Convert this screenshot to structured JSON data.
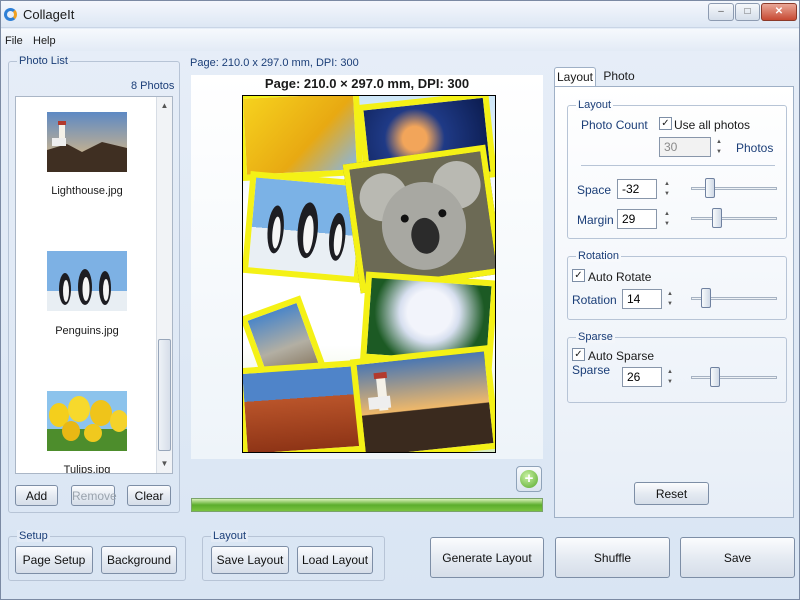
{
  "window": {
    "title": "CollageIt",
    "controls": [
      "–",
      "□",
      "✕"
    ]
  },
  "menu": {
    "file": "File",
    "help": "Help"
  },
  "photo_list": {
    "title": "Photo List",
    "count": "8 Photos",
    "items": [
      {
        "label": "Lighthouse.jpg"
      },
      {
        "label": "Penguins.jpg"
      },
      {
        "label": "Tulips.jpg"
      }
    ],
    "add": "Add",
    "remove": "Remove",
    "clear": "Clear"
  },
  "page": {
    "info_small": "Page: 210.0 x 297.0 mm, DPI: 300",
    "info_large": "Page: 210.0 × 297.0 mm, DPI: 300"
  },
  "tabs": {
    "layout": "Layout",
    "photo": "Photo",
    "active": "Layout"
  },
  "layout_group": {
    "title": "Layout",
    "photo_count_label": "Photo Count",
    "use_all_label": "Use all photos",
    "use_all_checked": true,
    "photo_count_value": "30",
    "photos_unit": "Photos",
    "space_label": "Space",
    "space_value": "-32",
    "margin_label": "Margin",
    "margin_value": "29"
  },
  "rotation_group": {
    "title": "Rotation",
    "auto_label": "Auto Rotate",
    "auto_checked": true,
    "rotation_label": "Rotation",
    "rotation_value": "14"
  },
  "sparse_group": {
    "title": "Sparse",
    "auto_label": "Auto Sparse",
    "auto_checked": true,
    "sparse_label": "Sparse",
    "sparse_value": "26"
  },
  "reset": "Reset",
  "setup_group": {
    "title": "Setup",
    "page_setup": "Page Setup",
    "background": "Background"
  },
  "layout_actions": {
    "title": "Layout",
    "save": "Save Layout",
    "load": "Load Layout"
  },
  "actions": {
    "generate": "Generate Layout",
    "shuffle": "Shuffle",
    "save": "Save"
  },
  "progress": {
    "value": 1.0
  },
  "colors": {
    "photo_border": "#f4f116",
    "progress": "#5cad2c"
  }
}
